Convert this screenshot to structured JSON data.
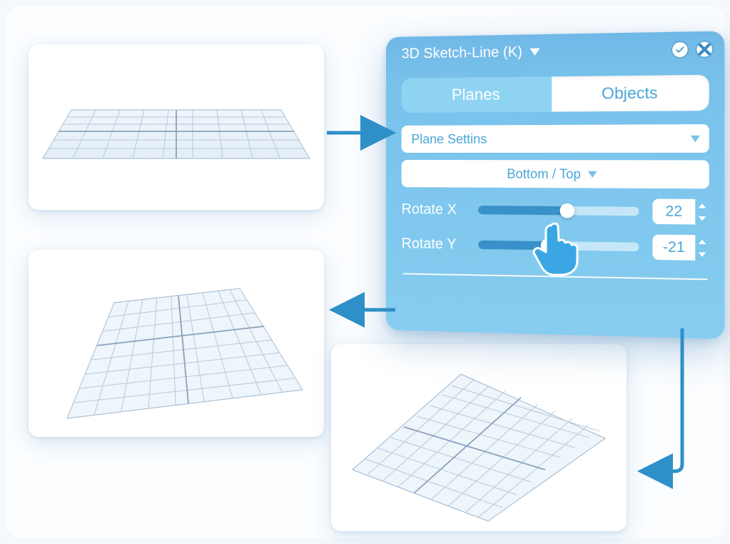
{
  "panel": {
    "title": "3D Sketch-Line (K)",
    "tabs": {
      "planes": "Planes",
      "objects": "Objects",
      "active": "planes"
    },
    "section_label": "Plane Settins",
    "plane_select": "Bottom / Top",
    "rotate_x": {
      "label": "Rotate X",
      "value": 22,
      "min": -180,
      "max": 180
    },
    "rotate_y": {
      "label": "Rotate Y",
      "value": -21,
      "min": -180,
      "max": 180
    }
  },
  "icons": {
    "confirm": "check-icon",
    "close": "close-icon",
    "dropdown": "chevron-down-icon",
    "pointer": "pointer-hand-icon"
  },
  "previews": {
    "a": "grid-plane-default",
    "b": "grid-plane-rotated-x",
    "c": "grid-plane-rotated-xy"
  },
  "colors": {
    "panel": "#78c1eb",
    "accent": "#3a91c9",
    "text_on_panel": "#ffffff",
    "field_text": "#4aa5d9"
  }
}
